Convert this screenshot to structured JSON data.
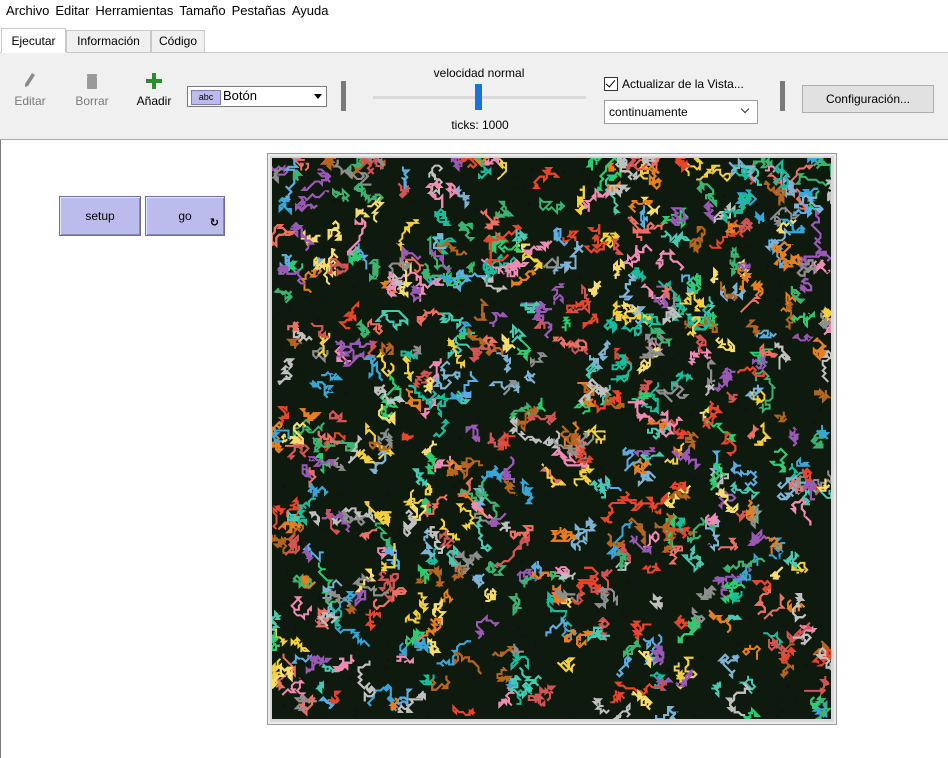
{
  "menu": [
    "Archivo",
    "Editar",
    "Herramientas",
    "Tamaño",
    "Pestañas",
    "Ayuda"
  ],
  "tabs": [
    "Ejecutar",
    "Información",
    "Código"
  ],
  "toolbar": {
    "edit_label": "Editar",
    "delete_label": "Borrar",
    "add_label": "Añadir",
    "widget_selected": "Botón",
    "widget_icon_text": "abc",
    "speed_label": "velocidad normal",
    "ticks_text": "ticks: 1000",
    "update_view_label": "Actualizar de la Vista...",
    "update_view_checked": true,
    "update_mode": "continuamente",
    "settings_label": "Configuración..."
  },
  "buttons": {
    "setup": "setup",
    "go": "go"
  },
  "colors": {
    "button_bg": "#bcbcec",
    "slider_thumb": "#1a73d9",
    "add_icon": "#2e8b2e",
    "world_bg": "#0d1a0d"
  }
}
